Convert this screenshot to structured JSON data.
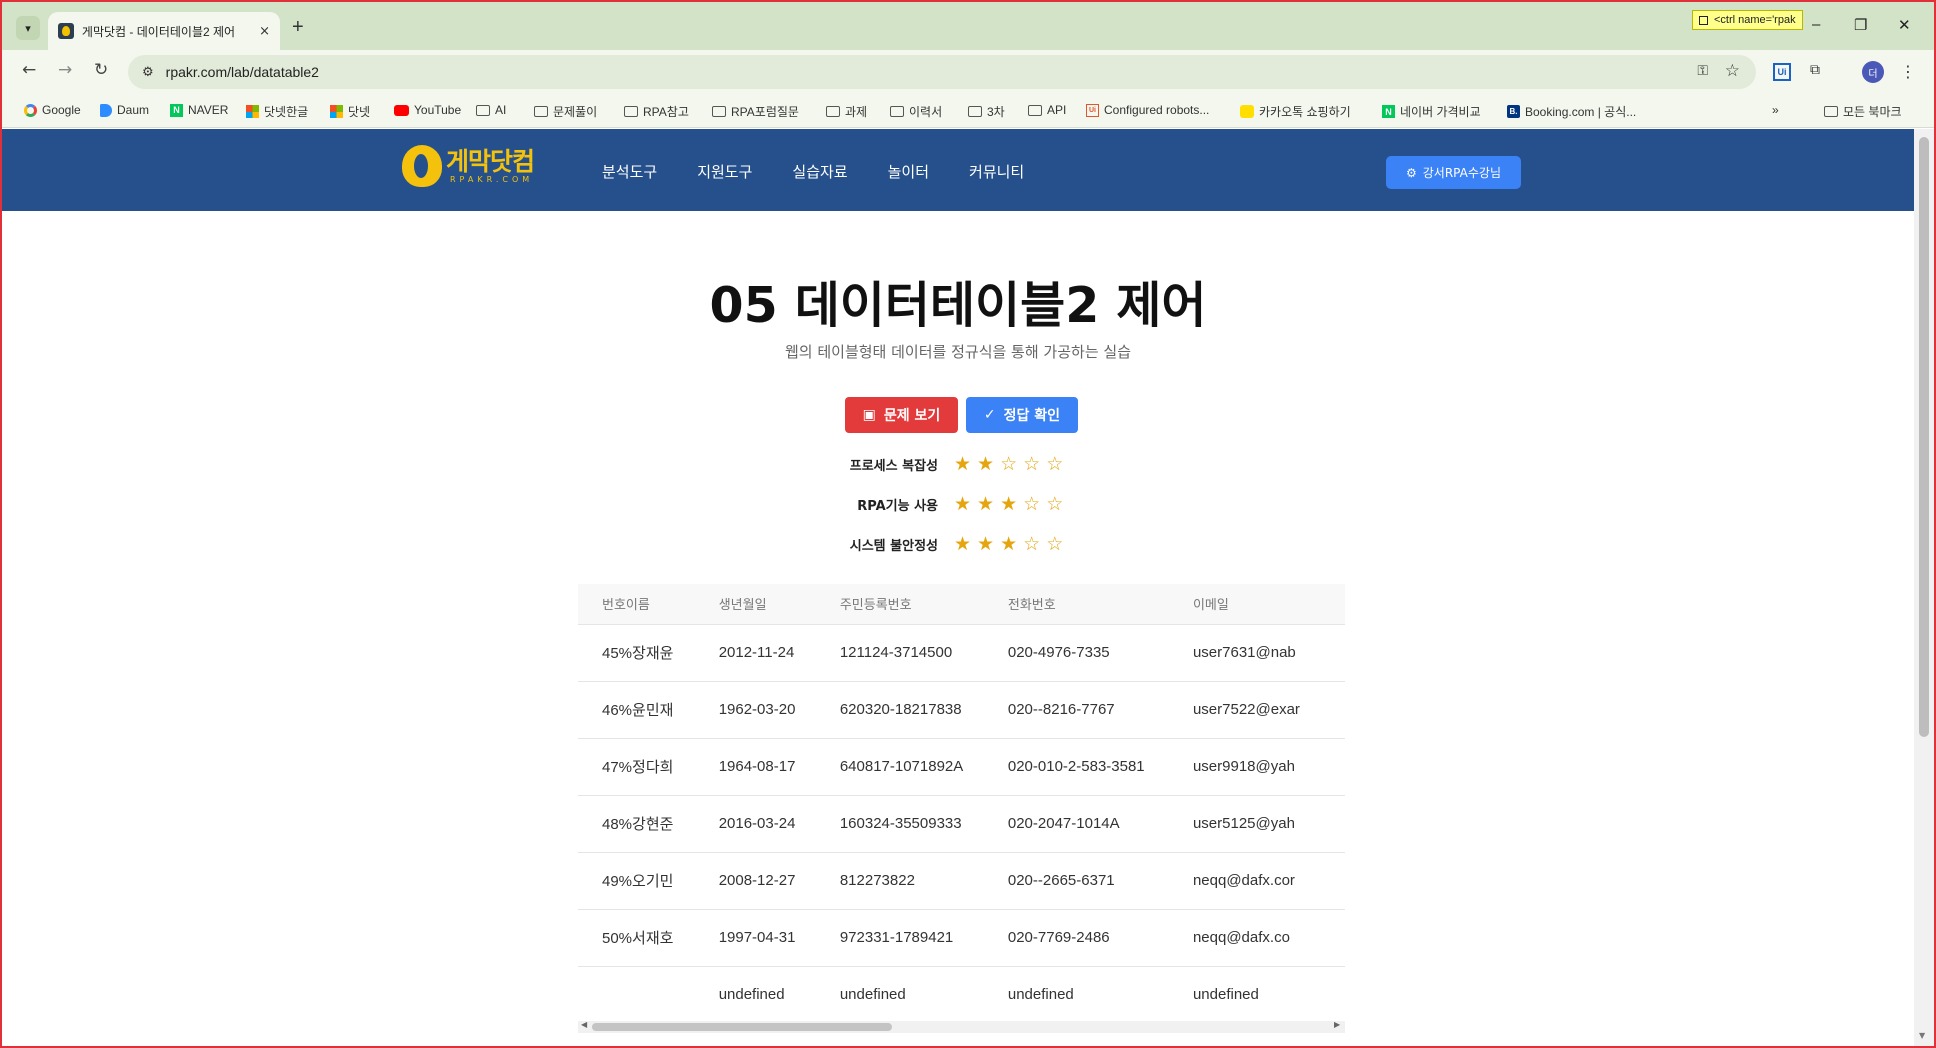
{
  "browser": {
    "tab_title": "게막닷컴 - 데이터테이블2 제어",
    "tab_close": "×",
    "new_tab": "+",
    "url": "rpakr.com/lab/datatable2",
    "ctrl_tooltip": "<ctrl name='rpak",
    "profile_initial": "더",
    "bookmarks": [
      {
        "icon": "google-icon",
        "label": "Google"
      },
      {
        "icon": "daum-icon",
        "label": "Daum"
      },
      {
        "icon": "naver-icon",
        "label": "NAVER"
      },
      {
        "icon": "windows-icon",
        "label": "닷넷한글"
      },
      {
        "icon": "windows-icon",
        "label": "닷넷"
      },
      {
        "icon": "youtube-icon",
        "label": "YouTube"
      },
      {
        "icon": "folder-icon",
        "label": "AI"
      },
      {
        "icon": "folder-icon",
        "label": "문제풀이"
      },
      {
        "icon": "folder-icon",
        "label": "RPA참고"
      },
      {
        "icon": "folder-icon",
        "label": "RPA포럼질문"
      },
      {
        "icon": "folder-icon",
        "label": "과제"
      },
      {
        "icon": "folder-icon",
        "label": "이력서"
      },
      {
        "icon": "folder-icon",
        "label": "3차"
      },
      {
        "icon": "folder-icon",
        "label": "API"
      },
      {
        "icon": "uipath-icon",
        "label": "Configured robots..."
      },
      {
        "icon": "kakao-icon",
        "label": "카카오톡 쇼핑하기"
      },
      {
        "icon": "naver-icon",
        "label": "네이버 가격비교"
      },
      {
        "icon": "booking-icon",
        "label": "Booking.com | 공식..."
      }
    ],
    "all_bookmarks": "모든 북마크"
  },
  "site": {
    "logo_kor": "게막닷컴",
    "logo_eng": "RPAKR.COM",
    "nav": [
      "분석도구",
      "지원도구",
      "실습자료",
      "놀이터",
      "커뮤니티"
    ],
    "cta": "강서RPA수강님"
  },
  "main": {
    "title": "05 데이터테이블2 제어",
    "subtitle": "웹의 테이블형태 데이터를 정규식을 통해 가공하는 실습",
    "btn_problem": "문제 보기",
    "btn_answer": "정답 확인",
    "ratings": [
      {
        "label": "프로세스 복잡성",
        "filled": 2,
        "total": 5
      },
      {
        "label": "RPA기능 사용",
        "filled": 3,
        "total": 5
      },
      {
        "label": "시스템 불안정성",
        "filled": 3,
        "total": 5
      }
    ]
  },
  "table": {
    "headers": [
      "번호이름",
      "생년월일",
      "주민등록번호",
      "전화번호",
      "이메일"
    ],
    "rows": [
      [
        "45%장재윤",
        "2012-11-24",
        "121124-3714500",
        "020-4976-7335",
        "user7631@nab"
      ],
      [
        "46%윤민재",
        "1962-03-20",
        "620320-18217838",
        "020--8216-7767",
        "user7522@exar"
      ],
      [
        "47%정다희",
        "1964-08-17",
        "640817-1071892A",
        "020-010-2-583-3581",
        "user9918@yah"
      ],
      [
        "48%강현준",
        "2016-03-24",
        "160324-35509333",
        "020-2047-1014A",
        "user5125@yah"
      ],
      [
        "49%오기민",
        "2008-12-27",
        "812273822",
        "020--2665-6371",
        "neqq@dafx.cor"
      ],
      [
        "50%서재호",
        "1997-04-31",
        "972331-1789421",
        "020-7769-2486",
        "neqq@dafx.co"
      ],
      [
        "",
        "undefined",
        "undefined",
        "undefined",
        "undefined"
      ]
    ]
  },
  "colors": {
    "header_bg": "#25508c",
    "logo": "#f4c20d",
    "btn_problem": "#e33b3b",
    "btn_answer": "#3b82f6",
    "star": "#e5a50f"
  }
}
